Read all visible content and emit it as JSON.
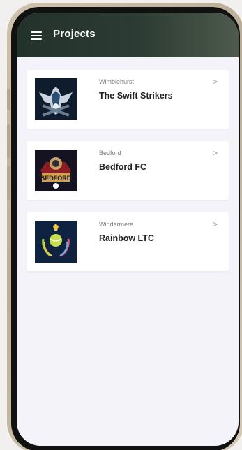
{
  "app_bar": {
    "title": "Projects"
  },
  "projects": [
    {
      "location": "Wimblehurst",
      "name": "The Swift Strikers",
      "chevron": ">"
    },
    {
      "location": "Bedford",
      "name": "Bedford FC",
      "logo_text": "BEDFORD",
      "chevron": ">"
    },
    {
      "location": "Windermere",
      "name": "Rainbow LTC",
      "chevron": ">"
    }
  ],
  "colors": {
    "app_bar": "#2c3b33",
    "background": "#f4f3fa",
    "card": "#ffffff"
  }
}
